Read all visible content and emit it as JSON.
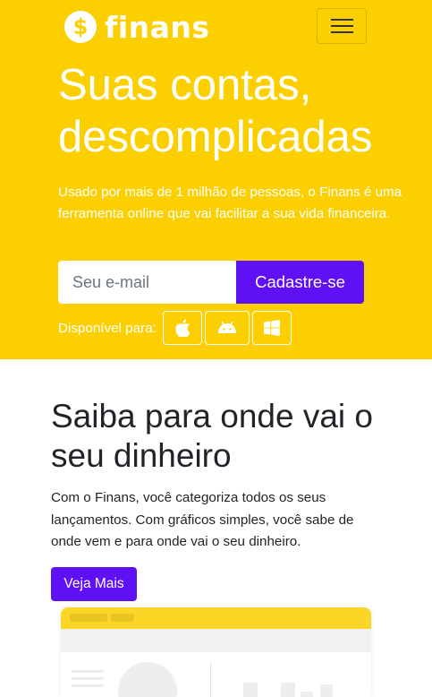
{
  "navbar": {
    "brand_symbol": "$",
    "brand_name": "finans",
    "menu_icon": "hamburger-icon"
  },
  "hero": {
    "title": "Suas contas, descomplicadas",
    "lead": "Usado por mais de 1 milhão de pessoas, o Finans é uma ferramenta online que vai facilitar a sua vida financeira.",
    "email_placeholder": "Seu e-mail",
    "signup_label": "Cadastre-se",
    "available_label": "Disponível para:",
    "platforms": [
      "apple-icon",
      "android-icon",
      "windows-icon"
    ]
  },
  "features": {
    "title": "Saiba para onde vai o seu dinheiro",
    "text": "Com o Finans, você categoriza todos os seus lançamentos. Com gráficos simples, você sabe de onde vem e para onde vai o seu dinheiro.",
    "button_label": "Veja Mais"
  },
  "colors": {
    "brand_yellow": "#fcd000",
    "accent_purple": "#5f10f4"
  }
}
